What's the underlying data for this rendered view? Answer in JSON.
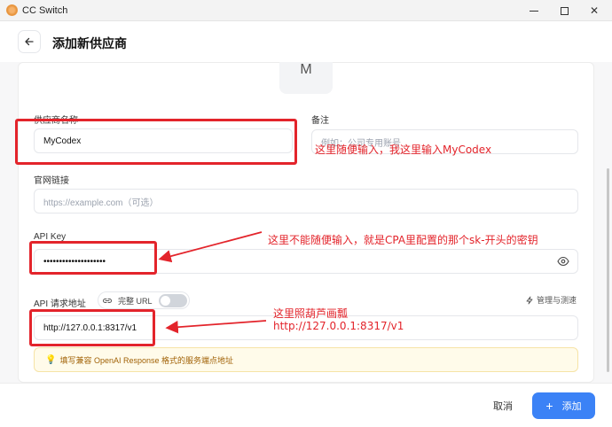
{
  "window": {
    "title": "CC Switch"
  },
  "header": {
    "title": "添加新供应商"
  },
  "avatar": {
    "letter": "M"
  },
  "form": {
    "provider_name": {
      "label": "供应商名称",
      "value": "MyCodex"
    },
    "notes": {
      "label": "备注",
      "placeholder": "例如：公司专用账号"
    },
    "website": {
      "label": "官网链接",
      "placeholder": "https://example.com（可选）"
    },
    "api_key": {
      "label": "API Key",
      "value": "••••••••••••••••••••"
    },
    "api_url": {
      "label": "API 请求地址",
      "value": "http://127.0.0.1:8317/v1"
    },
    "full_url_toggle": {
      "label": "完整 URL",
      "on": false
    },
    "manage_link": "管理与测速",
    "hint": "填写兼容 OpenAI Response 格式的服务端点地址"
  },
  "annotations": {
    "name_note": "这里随便输入，我这里输入MyCodex",
    "key_note": "这里不能随便输入，就是CPA里配置的那个sk-开头的密钥",
    "url_note_line1": "这里照葫芦画瓢",
    "url_note_line2": "http://127.0.0.1:8317/v1"
  },
  "footer": {
    "cancel": "取消",
    "add": "添加"
  },
  "colors": {
    "accent": "#3b82f6",
    "annotation": "#e3242b"
  }
}
